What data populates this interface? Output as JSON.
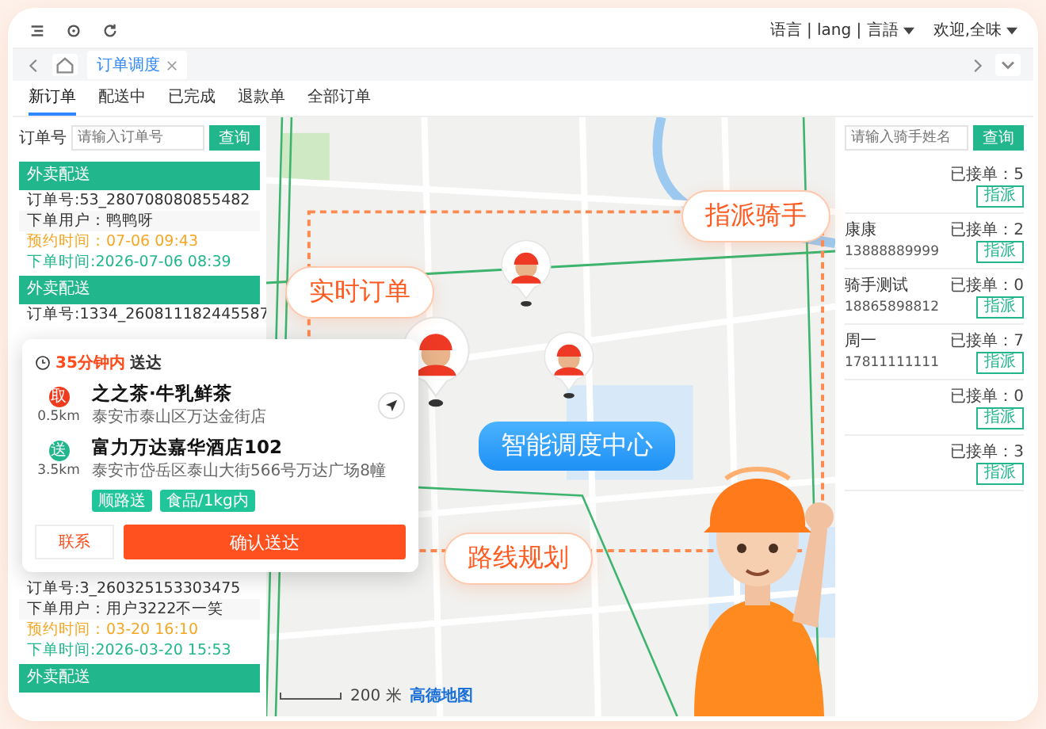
{
  "topbar": {
    "language": "语言 | lang | 言語",
    "user": "欢迎,全味"
  },
  "tabs": [
    {
      "label": "订单调度",
      "selected": true
    }
  ],
  "order_tabs": [
    {
      "label": "新订单",
      "selected": true
    },
    {
      "label": "配送中",
      "selected": false
    },
    {
      "label": "已完成",
      "selected": false
    },
    {
      "label": "退款单",
      "selected": false
    },
    {
      "label": "全部订单",
      "selected": false
    }
  ],
  "order_search": {
    "label": "订单号",
    "placeholder": "请输入订单号",
    "button": "查询"
  },
  "orders": [
    {
      "header": "外卖配送",
      "order_no": "订单号:53_280708080855482",
      "user": "下单用户：鸭鸭呀",
      "scheduled": "预约时间：07-06 09:43",
      "placed": "下单时间:2026-07-06 08:39"
    },
    {
      "header": "外卖配送",
      "order_no": "订单号:1334_260811182445587"
    },
    {
      "order_no": "订单号:3_260325153303475",
      "user": "下单用户：用户3222不一笑",
      "scheduled": "预约时间：03-20 16:10",
      "placed": "下单时间:2026-03-20 15:53"
    },
    {
      "header": "外卖配送"
    }
  ],
  "delivery_card": {
    "eta_highlight": "35分钟内",
    "eta_rest": "送达",
    "stops": [
      {
        "kind": "pickup",
        "badge": "取",
        "distance": "0.5km",
        "name": "之之茶·牛乳鲜茶",
        "address": "泰安市泰山区万达金街店"
      },
      {
        "kind": "dropoff",
        "badge": "送",
        "distance": "3.5km",
        "name": "富力万达嘉华酒店102",
        "address": "泰安市岱岳区泰山大街566号万达广场8幢"
      }
    ],
    "tags": [
      "顺路送",
      "食品/1kg内"
    ],
    "secondary_button": "联系",
    "primary_button": "确认送达"
  },
  "map": {
    "scale": "200 米",
    "logo": "高德地图"
  },
  "rider_search": {
    "placeholder": "请输入骑手姓名",
    "button": "查询"
  },
  "riders": [
    {
      "orders": "已接单：5",
      "button": "指派"
    },
    {
      "name": "康康",
      "phone": "13888889999",
      "orders": "已接单：2",
      "button": "指派"
    },
    {
      "name": "骑手测试",
      "phone": "18865898812",
      "orders": "已接单：0",
      "button": "指派"
    },
    {
      "name": "周一",
      "phone": "17811111111",
      "orders": "已接单：7",
      "button": "指派"
    },
    {
      "orders": "已接单：0",
      "button": "指派"
    },
    {
      "orders": "已接单：3",
      "button": "指派"
    }
  ],
  "callouts": [
    {
      "kind": "orange",
      "text": "实时订单"
    },
    {
      "kind": "orange",
      "text": "指派骑手"
    },
    {
      "kind": "blue",
      "text": "智能调度中心"
    },
    {
      "kind": "orange",
      "text": "路线规划"
    }
  ]
}
